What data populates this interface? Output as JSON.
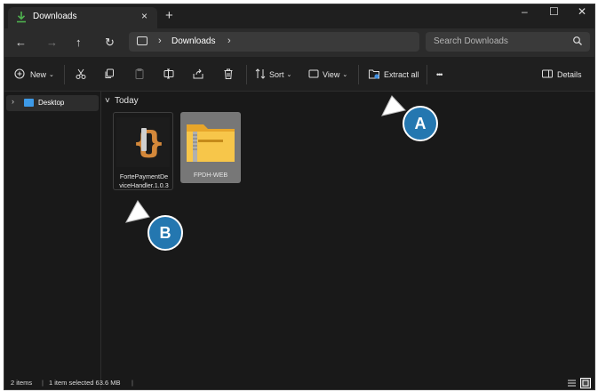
{
  "window": {
    "tab_title": "Downloads",
    "tab_close": "×",
    "new_tab": "+",
    "controls": {
      "minimize": "–",
      "maximize": "☐",
      "close": "✕"
    }
  },
  "address_bar": {
    "back": "←",
    "forward": "→",
    "up": "↑",
    "refresh": "↻",
    "separator": "›",
    "crumb": "Downloads",
    "search_placeholder": "Search Downloads"
  },
  "toolbar": {
    "new_label": "New",
    "sort_label": "Sort",
    "view_label": "View",
    "extract_label": "Extract all",
    "more_label": "•••",
    "details_label": "Details"
  },
  "sidebar": {
    "items": [
      {
        "label": "Desktop",
        "chevron": "›"
      }
    ]
  },
  "content": {
    "group_label": "Today",
    "group_chevron": "˅",
    "files": [
      {
        "name_line1": "FortePaymentDe",
        "name_line2": "viceHandler.1.0.3",
        "icon": "json-file-icon",
        "selected": false
      },
      {
        "name_line1": "FPDH-WEB",
        "icon": "zip-folder-icon",
        "selected": true
      }
    ]
  },
  "status_bar": {
    "items_count": "2 items",
    "selection": "1 item selected  63.6 MB"
  },
  "callouts": [
    {
      "letter": "A",
      "color": "#2477b0"
    },
    {
      "letter": "B",
      "color": "#2477b0"
    }
  ]
}
